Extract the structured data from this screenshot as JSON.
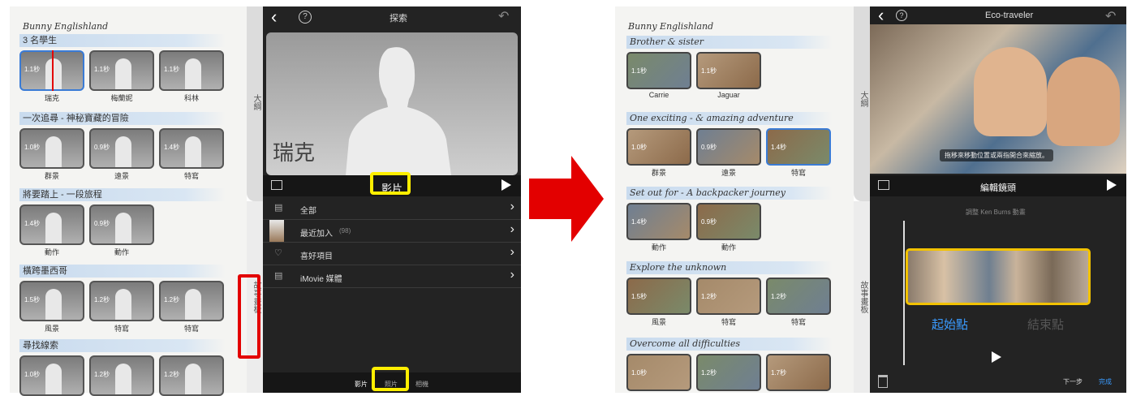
{
  "left": {
    "app_title": "Bunny Englishland",
    "sections": [
      {
        "title": "3 名學生",
        "items": [
          {
            "dur": "1.1秒",
            "label": "瑞克"
          },
          {
            "dur": "1.1秒",
            "label": "梅蘭妮"
          },
          {
            "dur": "1.1秒",
            "label": "科林"
          }
        ]
      },
      {
        "title": "一次追尋 - 神秘寶藏的冒險",
        "items": [
          {
            "dur": "1.0秒",
            "label": "群景"
          },
          {
            "dur": "0.9秒",
            "label": "遠景"
          },
          {
            "dur": "1.4秒",
            "label": "特寫"
          }
        ]
      },
      {
        "title": "將要踏上 - 一段旅程",
        "items": [
          {
            "dur": "1.4秒",
            "label": "動作"
          },
          {
            "dur": "0.9秒",
            "label": "動作"
          }
        ]
      },
      {
        "title": "橫跨墨西哥",
        "items": [
          {
            "dur": "1.5秒",
            "label": "風景"
          },
          {
            "dur": "1.2秒",
            "label": "特寫"
          },
          {
            "dur": "1.2秒",
            "label": "特寫"
          }
        ]
      },
      {
        "title": "尋找線索",
        "items": [
          {
            "dur": "1.0秒",
            "label": ""
          },
          {
            "dur": "1.2秒",
            "label": ""
          },
          {
            "dur": "1.2秒",
            "label": ""
          }
        ]
      }
    ],
    "tab_outline": "大綱",
    "tab_storyboard": "故事畫板",
    "browser": {
      "title": "探索",
      "help": "?",
      "back": "‹",
      "undo": "↶",
      "preview_name": "瑞克",
      "media_label": "影片",
      "rows": [
        {
          "label": "全部",
          "count": ""
        },
        {
          "label": "最近加入",
          "count": "(98)"
        },
        {
          "label": "喜好項目",
          "count": ""
        },
        {
          "label": "iMovie 媒體",
          "count": ""
        }
      ],
      "bottom_tabs": [
        "影片",
        "照片",
        "相機"
      ]
    }
  },
  "arrow_color": "#e30000",
  "highlight_color": "#ffee00",
  "right": {
    "app_title": "Bunny Englishland",
    "sections": [
      {
        "title": "Brother & sister",
        "items": [
          {
            "dur": "1.1秒",
            "label": "Carrie"
          },
          {
            "dur": "1.1秒",
            "label": "Jaguar"
          }
        ]
      },
      {
        "title": "One exciting - & amazing adventure",
        "items": [
          {
            "dur": "1.0秒",
            "label": "群景"
          },
          {
            "dur": "0.9秒",
            "label": "遠景"
          },
          {
            "dur": "1.4秒",
            "label": "特寫"
          }
        ]
      },
      {
        "title": "Set out for - A backpacker journey",
        "items": [
          {
            "dur": "1.4秒",
            "label": "動作"
          },
          {
            "dur": "0.9秒",
            "label": "動作"
          }
        ]
      },
      {
        "title": "Explore the unknown",
        "items": [
          {
            "dur": "1.5秒",
            "label": "風景"
          },
          {
            "dur": "1.2秒",
            "label": "特寫"
          },
          {
            "dur": "1.2秒",
            "label": "特寫"
          }
        ]
      },
      {
        "title": "Overcome all difficulties",
        "items": [
          {
            "dur": "1.0秒",
            "label": ""
          },
          {
            "dur": "1.2秒",
            "label": ""
          },
          {
            "dur": "1.7秒",
            "label": ""
          }
        ]
      }
    ],
    "tab_outline": "大綱",
    "tab_storyboard": "故事畫板",
    "editor": {
      "title": "Eco-traveler",
      "overlay_hint": "拖移來移動位置或兩指開合來縮放。",
      "edit_label": "編輯鏡頭",
      "kb_label": "調整 Ken Burns 動畫",
      "start_label": "起始點",
      "end_label": "結束點",
      "next_label": "下一步",
      "done_label": "完成"
    }
  }
}
